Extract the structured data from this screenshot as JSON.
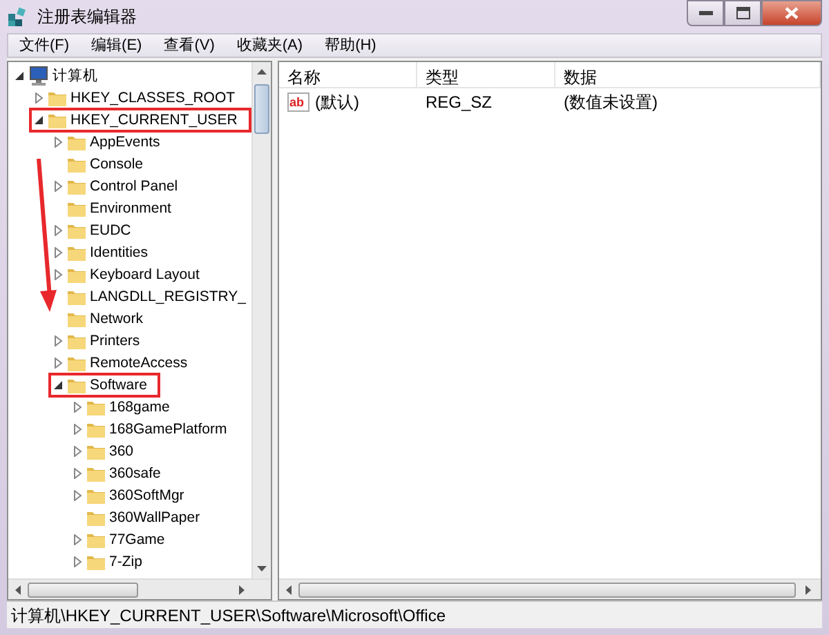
{
  "window": {
    "title": "注册表编辑器"
  },
  "menu": [
    "文件(F)",
    "编辑(E)",
    "查看(V)",
    "收藏夹(A)",
    "帮助(H)"
  ],
  "tree": [
    {
      "label": "计算机",
      "kind": "computer",
      "expandable": true,
      "expanded": true,
      "highlighted": false,
      "children": [
        {
          "label": "HKEY_CLASSES_ROOT",
          "kind": "folder",
          "expandable": true,
          "expanded": false,
          "highlighted": false
        },
        {
          "label": "HKEY_CURRENT_USER",
          "kind": "folder",
          "expandable": true,
          "expanded": true,
          "highlighted": true,
          "children": [
            {
              "label": "AppEvents",
              "kind": "folder",
              "expandable": true,
              "expanded": false,
              "highlighted": false
            },
            {
              "label": "Console",
              "kind": "folder",
              "expandable": false,
              "highlighted": false
            },
            {
              "label": "Control Panel",
              "kind": "folder",
              "expandable": true,
              "expanded": false,
              "highlighted": false
            },
            {
              "label": "Environment",
              "kind": "folder",
              "expandable": false,
              "highlighted": false
            },
            {
              "label": "EUDC",
              "kind": "folder",
              "expandable": true,
              "expanded": false,
              "highlighted": false
            },
            {
              "label": "Identities",
              "kind": "folder",
              "expandable": true,
              "expanded": false,
              "highlighted": false
            },
            {
              "label": "Keyboard Layout",
              "kind": "folder",
              "expandable": true,
              "expanded": false,
              "highlighted": false
            },
            {
              "label": "LANGDLL_REGISTRY_",
              "kind": "folder",
              "expandable": false,
              "highlighted": false
            },
            {
              "label": "Network",
              "kind": "folder",
              "expandable": false,
              "highlighted": false
            },
            {
              "label": "Printers",
              "kind": "folder",
              "expandable": true,
              "expanded": false,
              "highlighted": false
            },
            {
              "label": "RemoteAccess",
              "kind": "folder",
              "expandable": true,
              "expanded": false,
              "highlighted": false
            },
            {
              "label": "Software",
              "kind": "folder",
              "expandable": true,
              "expanded": true,
              "highlighted": true,
              "children": [
                {
                  "label": "168game",
                  "kind": "folder",
                  "expandable": true,
                  "expanded": false,
                  "highlighted": false
                },
                {
                  "label": "168GamePlatform",
                  "kind": "folder",
                  "expandable": true,
                  "expanded": false,
                  "highlighted": false
                },
                {
                  "label": "360",
                  "kind": "folder",
                  "expandable": true,
                  "expanded": false,
                  "highlighted": false
                },
                {
                  "label": "360safe",
                  "kind": "folder",
                  "expandable": true,
                  "expanded": false,
                  "highlighted": false
                },
                {
                  "label": "360SoftMgr",
                  "kind": "folder",
                  "expandable": true,
                  "expanded": false,
                  "highlighted": false
                },
                {
                  "label": "360WallPaper",
                  "kind": "folder",
                  "expandable": false,
                  "highlighted": false
                },
                {
                  "label": "77Game",
                  "kind": "folder",
                  "expandable": true,
                  "expanded": false,
                  "highlighted": false
                },
                {
                  "label": "7-Zip",
                  "kind": "folder",
                  "expandable": true,
                  "expanded": false,
                  "highlighted": false
                }
              ]
            }
          ]
        }
      ]
    }
  ],
  "list": {
    "columns": [
      "名称",
      "类型",
      "数据"
    ],
    "rows": [
      {
        "icon_text": "ab",
        "name": "(默认)",
        "type": "REG_SZ",
        "data": "(数值未设置)"
      }
    ]
  },
  "status_bar": "计算机\\HKEY_CURRENT_USER\\Software\\Microsoft\\Office"
}
